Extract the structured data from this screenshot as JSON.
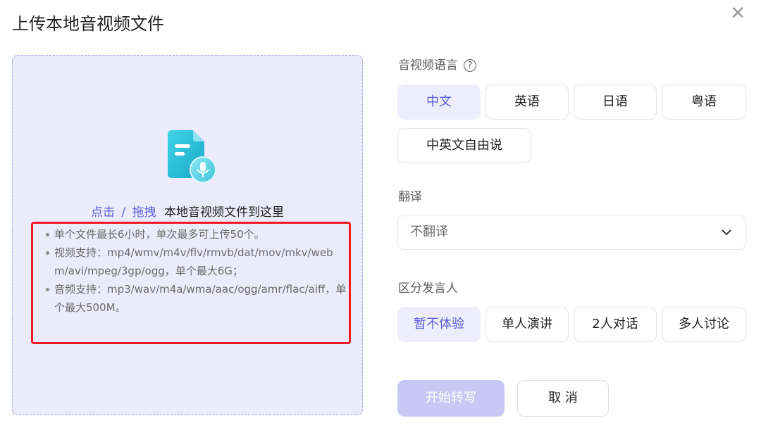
{
  "dialog": {
    "title": "上传本地音视频文件",
    "close_icon": "close-icon"
  },
  "upload": {
    "icon": "audio-file-icon",
    "click_text": "点击",
    "separator": "/",
    "drag_text": "拖拽",
    "rest_text": "本地音视频文件到这里",
    "notes": [
      "单个文件最长6小时，单次最多可上传50个。",
      "视频支持：mp4/wmv/m4v/flv/rmvb/dat/mov/mkv/webm/avi/mpeg/3gp/ogg，单个最大6G；",
      "音频支持：mp3/wav/m4a/wma/aac/ogg/amr/flac/aiff，单个最大500M。"
    ]
  },
  "language": {
    "label": "音视频语言",
    "help_icon": "question-circle-icon",
    "options": [
      "中文",
      "英语",
      "日语",
      "粤语",
      "中英文自由说"
    ],
    "selected": "中文"
  },
  "translate": {
    "label": "翻译",
    "value": "不翻译"
  },
  "speaker": {
    "label": "区分发言人",
    "options": [
      "暂不体验",
      "单人演讲",
      "2人对话",
      "多人讨论"
    ],
    "selected": "暂不体验"
  },
  "actions": {
    "start": "开始转写",
    "cancel": "取 消"
  },
  "colors": {
    "accent": "#5a5fd6",
    "dropzone_bg": "#ebebfb",
    "highlight_border": "#ee1c25",
    "start_disabled": "#c7c9f4"
  }
}
